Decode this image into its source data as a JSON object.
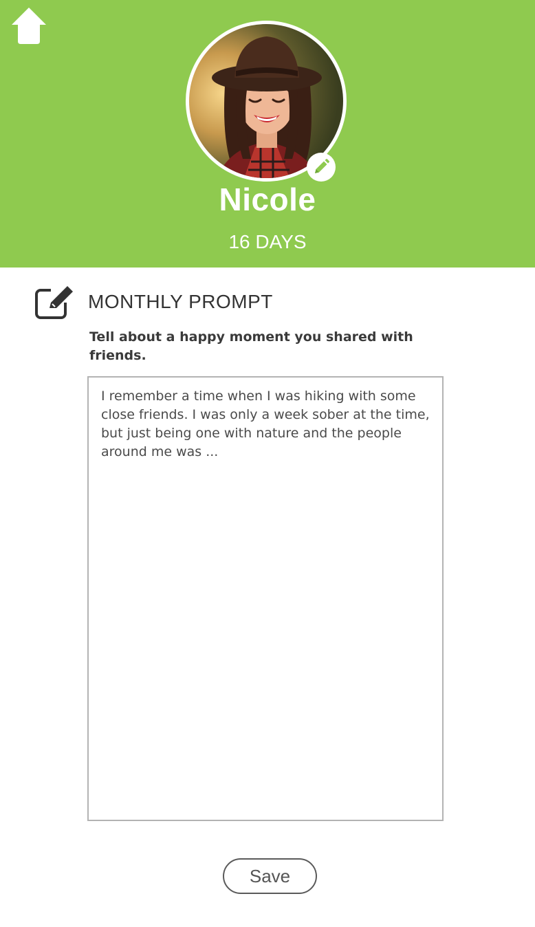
{
  "colors": {
    "header_bg": "#8fca4f",
    "accent": "#8fca4f",
    "text_dark": "#333333",
    "border": "#b3b3b3"
  },
  "header": {
    "home_icon": "home-icon",
    "avatar_icon": "avatar",
    "avatar_edit_icon": "pencil-icon",
    "user_name": "Nicole",
    "days_label": "16 DAYS"
  },
  "prompt": {
    "icon": "edit-square-icon",
    "title": "MONTHLY PROMPT",
    "question": "Tell about a happy moment you shared with friends.",
    "answer": "I remember a time when I was hiking with some close friends. I was only a week sober at the time, but just being one with nature and the people around me was ..."
  },
  "actions": {
    "save_label": "Save"
  }
}
